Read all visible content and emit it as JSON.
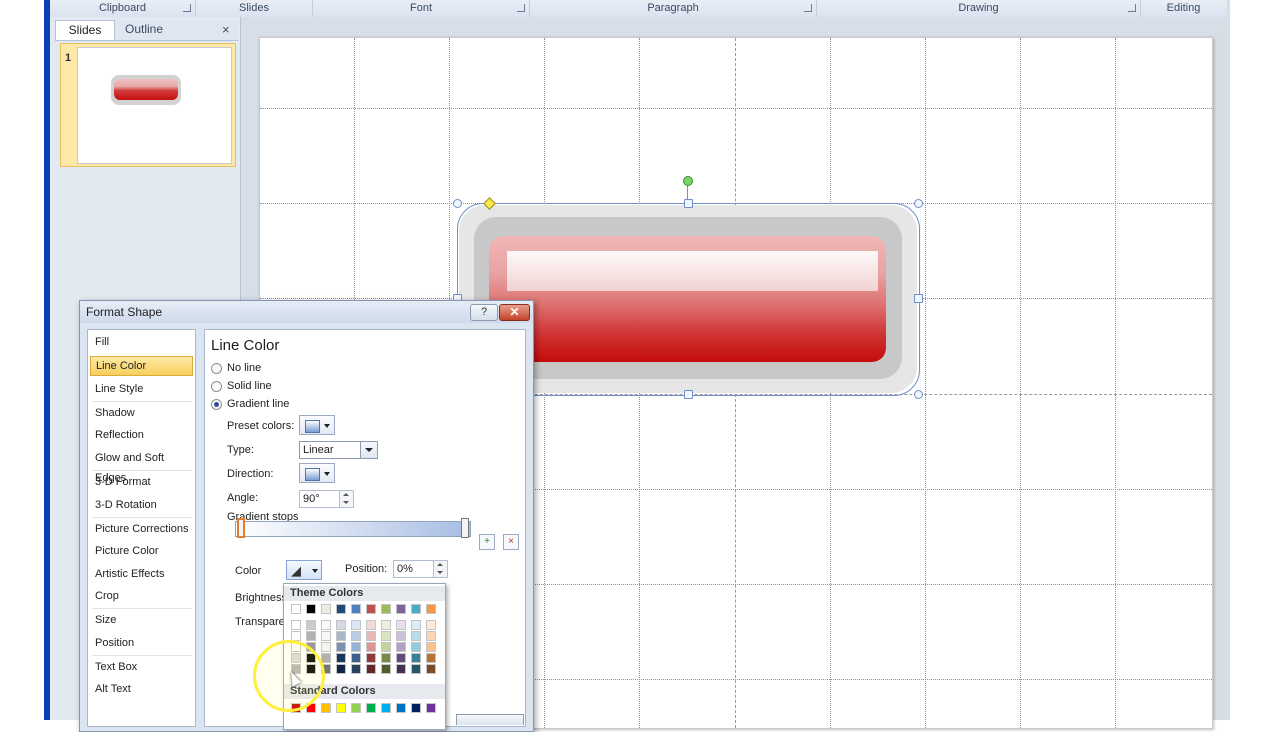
{
  "ribbon": {
    "groups": [
      "Clipboard",
      "Slides",
      "Font",
      "Paragraph",
      "Drawing",
      "Editing"
    ]
  },
  "slides_pane": {
    "tabs": [
      "Slides",
      "Outline"
    ],
    "close_glyph": "×",
    "slide_number": "1"
  },
  "dialog": {
    "title": "Format Shape",
    "help_glyph": "?",
    "close_glyph": "✕",
    "categories": [
      "Fill",
      "Line Color",
      "Line Style",
      "Shadow",
      "Reflection",
      "Glow and Soft Edges",
      "3-D Format",
      "3-D Rotation",
      "Picture Corrections",
      "Picture Color",
      "Artistic Effects",
      "Crop",
      "Size",
      "Position",
      "Text Box",
      "Alt Text"
    ],
    "selected_category": "Line Color",
    "panel": {
      "title": "Line Color",
      "options": [
        "No line",
        "Solid line",
        "Gradient line"
      ],
      "selected_option": "Gradient line",
      "preset_label": "Preset colors:",
      "type_label": "Type:",
      "type_value": "Linear",
      "direction_label": "Direction:",
      "angle_label": "Angle:",
      "angle_value": "90°",
      "gradient_stops_label": "Gradient stops",
      "color_label": "Color",
      "position_label": "Position:",
      "position_value": "0%",
      "brightness_label": "Brightness",
      "transparency_label": "Transparency"
    }
  },
  "color_popup": {
    "theme_header": "Theme Colors",
    "standard_header": "Standard Colors",
    "theme_top": [
      "#ffffff",
      "#000000",
      "#eeece1",
      "#1f497d",
      "#4f81bd",
      "#c0504d",
      "#9bbb59",
      "#8064a2",
      "#4bacc6",
      "#f79646"
    ],
    "standard": [
      "#c00000",
      "#ff0000",
      "#ffc000",
      "#ffff00",
      "#92d050",
      "#00b050",
      "#00b0f0",
      "#0070c0",
      "#002060",
      "#7030a0"
    ]
  },
  "colors": {
    "selection_accent": "#f7cf5b",
    "button_red": "#c40b0b",
    "window_blue": "#0a3fb3"
  }
}
